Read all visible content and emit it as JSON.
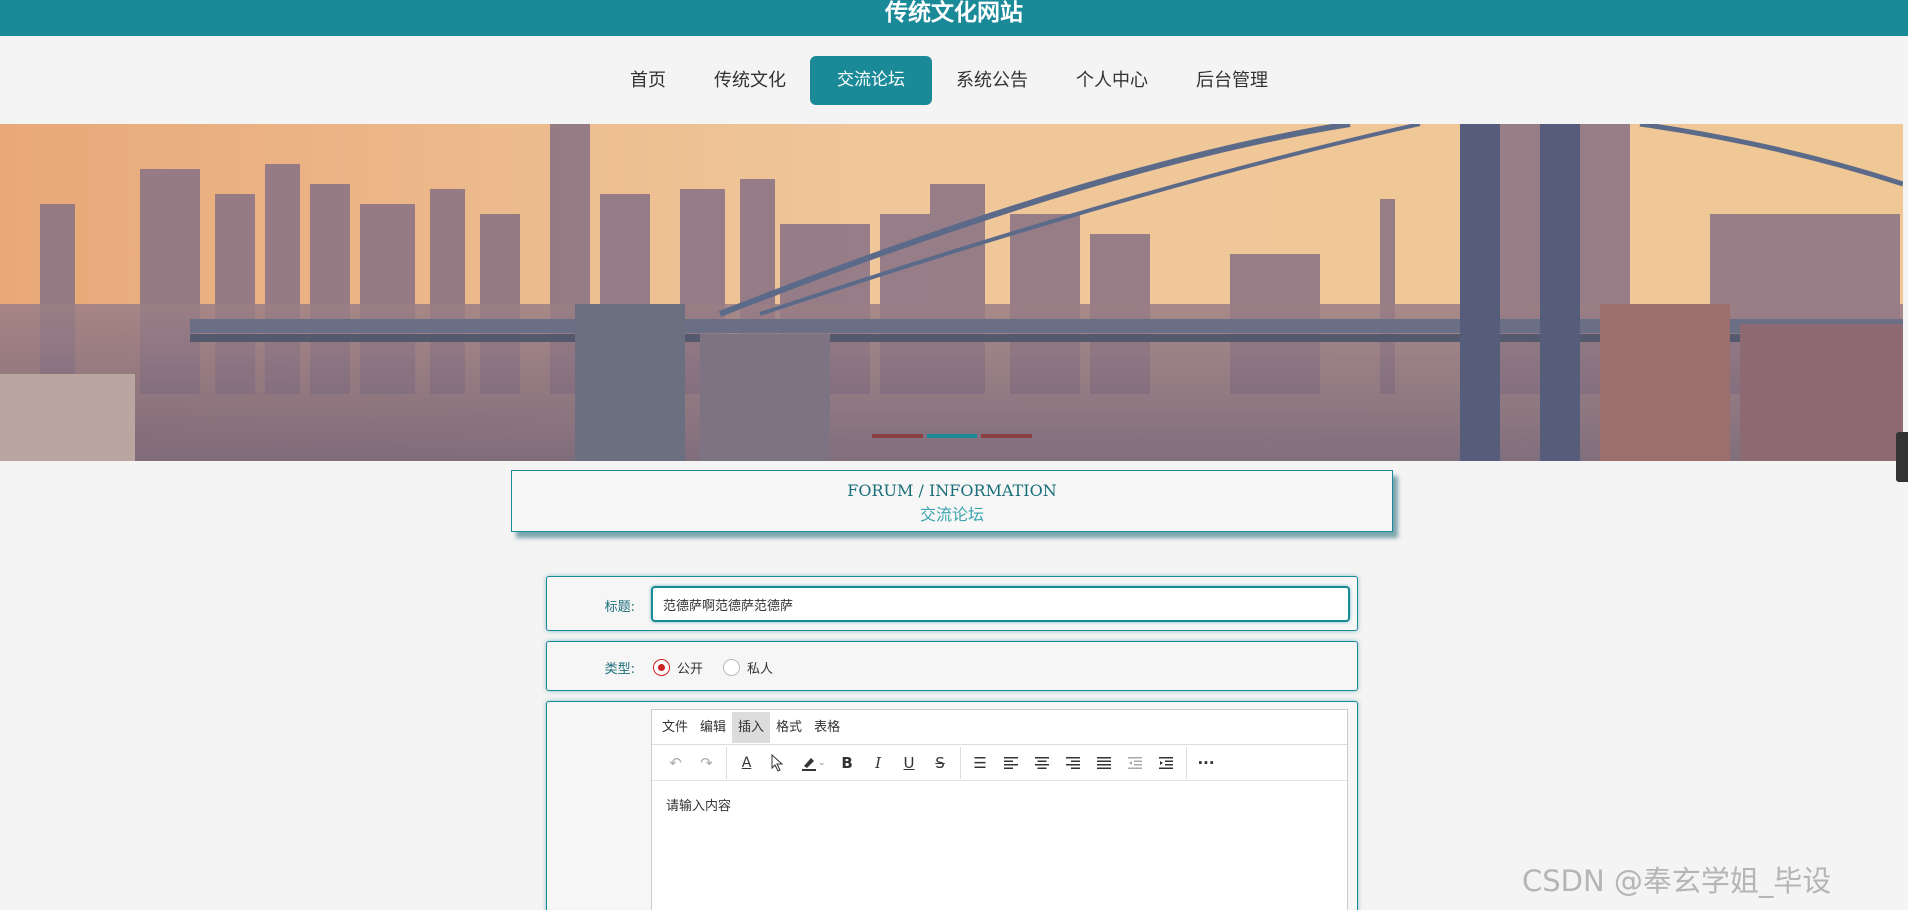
{
  "site": {
    "title": "传统文化网站"
  },
  "nav": {
    "items": [
      {
        "label": "首页"
      },
      {
        "label": "传统文化"
      },
      {
        "label": "交流论坛"
      },
      {
        "label": "系统公告"
      },
      {
        "label": "个人中心"
      },
      {
        "label": "后台管理"
      }
    ],
    "active_index": 2
  },
  "banner": {
    "slides": 3,
    "active_slide": 2
  },
  "section": {
    "en_title": "FORUM / INFORMATION",
    "cn_title": "交流论坛"
  },
  "form": {
    "title_label": "标题:",
    "title_value": "范德萨啊范德萨范德萨",
    "type_label": "类型:",
    "type_options": [
      {
        "label": "公开",
        "checked": true
      },
      {
        "label": "私人",
        "checked": false
      }
    ],
    "editor": {
      "menus": [
        "文件",
        "编辑",
        "插入",
        "格式",
        "表格"
      ],
      "active_menu": "插入",
      "placeholder": "请输入内容"
    }
  },
  "watermark": "CSDN @奉玄学姐_毕设",
  "colors": {
    "primary": "#1b8a98",
    "radio_checked": "#cc2222"
  }
}
